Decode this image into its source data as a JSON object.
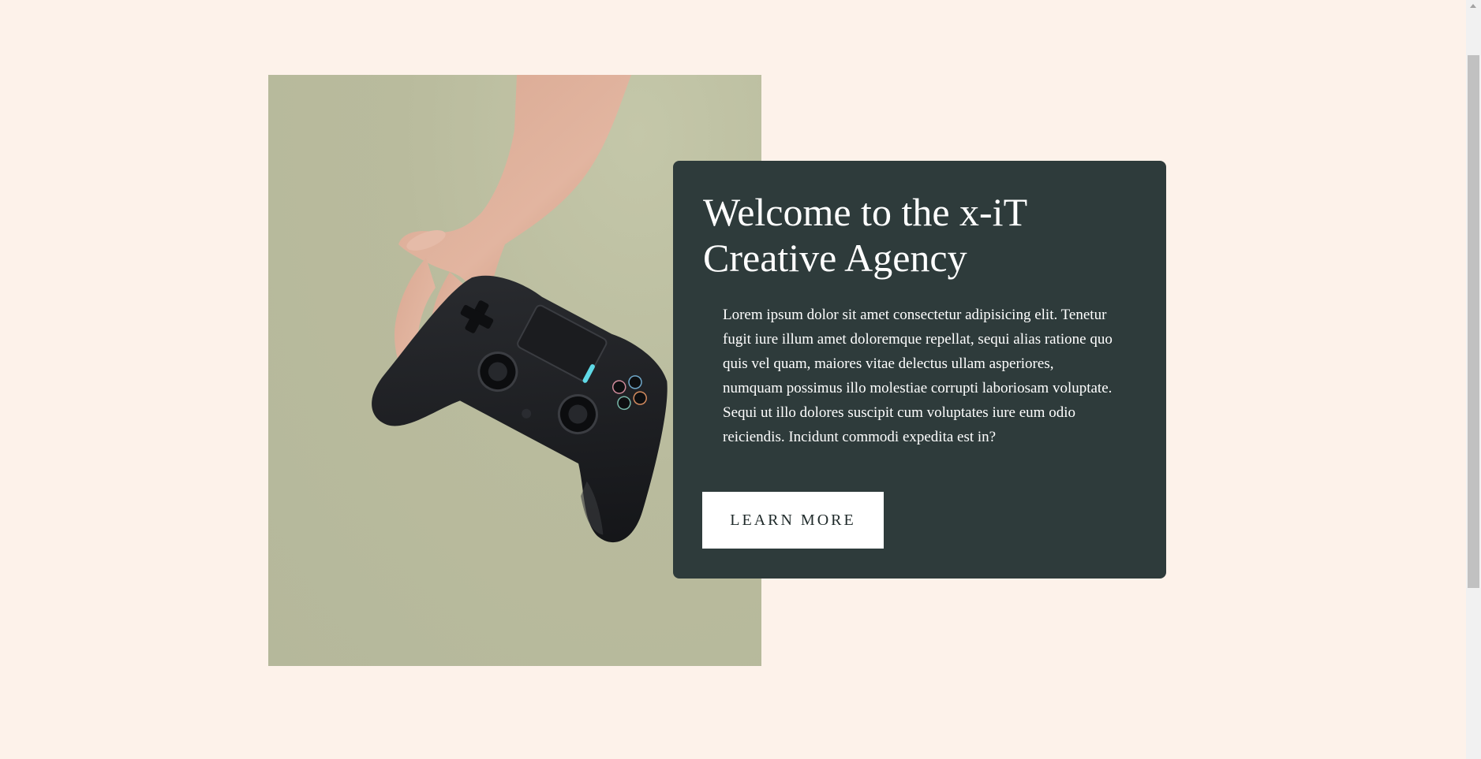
{
  "hero": {
    "title": "Welcome to the x-iT Creative Agency",
    "body": "Lorem ipsum dolor sit amet consectetur adipisicing elit. Tenetur fugit iure illum amet doloremque repellat, sequi alias ratione quo quis vel quam, maiores vitae delectus ullam asperiores, numquam possimus illo molestiae corrupti laboriosam voluptate. Sequi ut illo dolores suscipit cum voluptates iure eum odio reiciendis. Incidunt commodi expedita est in?",
    "cta_label": "LEARN MORE",
    "image": "hand-holding-game-controller-photo"
  },
  "colors": {
    "page_background": "#fdf2ea",
    "image_background": "#b7ba9c",
    "card_background": "#2e3b3b",
    "card_text": "#ffffff",
    "button_background": "#ffffff",
    "button_text": "#1f2a2a"
  },
  "icons": {
    "scroll_up": "triangle-up-icon"
  }
}
